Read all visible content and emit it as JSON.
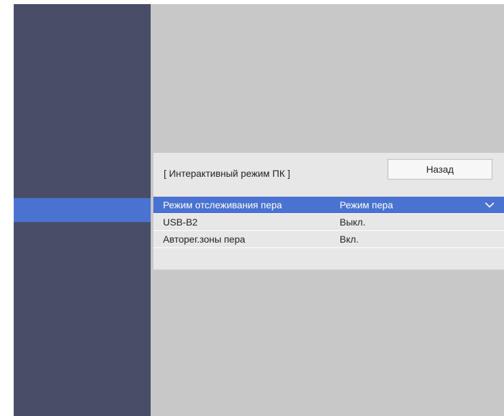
{
  "panel": {
    "title": "[ Интерактивный режим ПК ]",
    "back_label": "Назад"
  },
  "rows": [
    {
      "label": "Режим отслеживания пера",
      "value": "Режим пера",
      "selected": true
    },
    {
      "label": "USB-B2",
      "value": "Выкл.",
      "selected": false
    },
    {
      "label": "Авторег.зоны пера",
      "value": "Вкл.",
      "selected": false
    }
  ],
  "colors": {
    "sidebar": "#4a4d68",
    "highlight": "#4a72d0",
    "background": "#c8c8c8",
    "panel": "#e7e7e7"
  },
  "icons": {
    "dropdown": "chevron-down-icon"
  }
}
